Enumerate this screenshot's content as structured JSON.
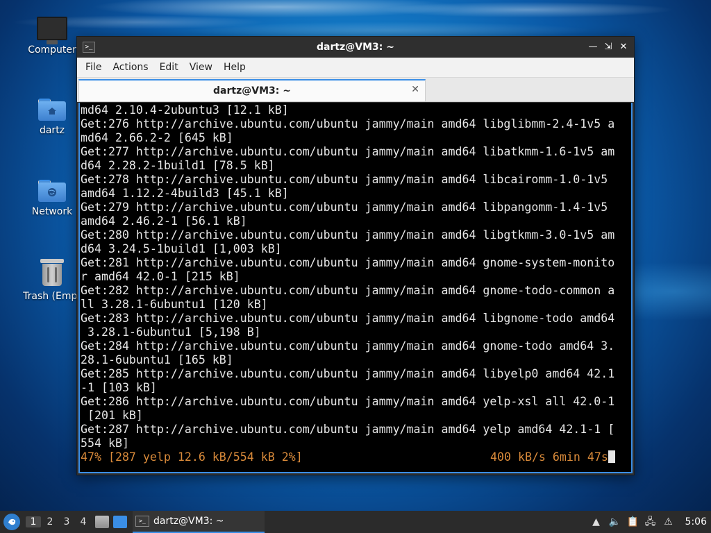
{
  "desktop": {
    "icons": [
      {
        "label": "Computer"
      },
      {
        "label": "dartz"
      },
      {
        "label": "Network"
      },
      {
        "label": "Trash (Empt"
      }
    ]
  },
  "window": {
    "title": "dartz@VM3: ~",
    "menu": [
      "File",
      "Actions",
      "Edit",
      "View",
      "Help"
    ],
    "tab_title": "dartz@VM3: ~",
    "terminal_lines": [
      "md64 2.10.4-2ubuntu3 [12.1 kB]",
      "Get:276 http://archive.ubuntu.com/ubuntu jammy/main amd64 libglibmm-2.4-1v5 a",
      "md64 2.66.2-2 [645 kB]",
      "Get:277 http://archive.ubuntu.com/ubuntu jammy/main amd64 libatkmm-1.6-1v5 am",
      "d64 2.28.2-1build1 [78.5 kB]",
      "Get:278 http://archive.ubuntu.com/ubuntu jammy/main amd64 libcairomm-1.0-1v5",
      "amd64 1.12.2-4build3 [45.1 kB]",
      "Get:279 http://archive.ubuntu.com/ubuntu jammy/main amd64 libpangomm-1.4-1v5",
      "amd64 2.46.2-1 [56.1 kB]",
      "Get:280 http://archive.ubuntu.com/ubuntu jammy/main amd64 libgtkmm-3.0-1v5 am",
      "d64 3.24.5-1build1 [1,003 kB]",
      "Get:281 http://archive.ubuntu.com/ubuntu jammy/main amd64 gnome-system-monito",
      "r amd64 42.0-1 [215 kB]",
      "Get:282 http://archive.ubuntu.com/ubuntu jammy/main amd64 gnome-todo-common a",
      "ll 3.28.1-6ubuntu1 [120 kB]",
      "Get:283 http://archive.ubuntu.com/ubuntu jammy/main amd64 libgnome-todo amd64",
      " 3.28.1-6ubuntu1 [5,198 B]",
      "Get:284 http://archive.ubuntu.com/ubuntu jammy/main amd64 gnome-todo amd64 3.",
      "28.1-6ubuntu1 [165 kB]",
      "Get:285 http://archive.ubuntu.com/ubuntu jammy/main amd64 libyelp0 amd64 42.1",
      "-1 [103 kB]",
      "Get:286 http://archive.ubuntu.com/ubuntu jammy/main amd64 yelp-xsl all 42.0-1",
      " [201 kB]",
      "Get:287 http://archive.ubuntu.com/ubuntu jammy/main amd64 yelp amd64 42.1-1 [",
      "554 kB]"
    ],
    "progress_left": "47% [287 yelp 12.6 kB/554 kB 2%]",
    "progress_right": "400 kB/s 6min 47s"
  },
  "taskbar": {
    "workspaces": [
      "1",
      "2",
      "3",
      "4"
    ],
    "active_workspace": "1",
    "task_label": "dartz@VM3: ~",
    "clock": "5:06"
  },
  "colors": {
    "accent": "#3a8ee6",
    "progress_text": "#d98a3a"
  }
}
